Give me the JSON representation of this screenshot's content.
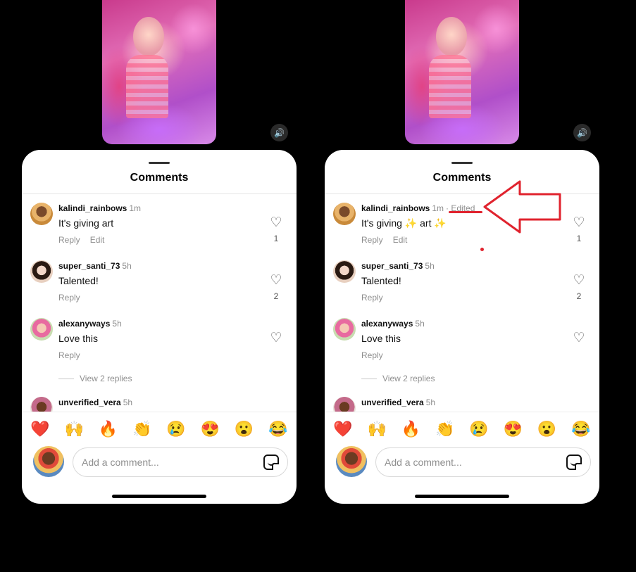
{
  "panels": [
    {
      "sheet_title": "Comments",
      "comments": [
        {
          "username": "kalindi_rainbows",
          "time": "1m",
          "edited": "",
          "text": "It's giving art",
          "actions": [
            "Reply",
            "Edit"
          ],
          "likes": "1"
        },
        {
          "username": "super_santi_73",
          "time": "5h",
          "edited": "",
          "text": "Talented!",
          "actions": [
            "Reply"
          ],
          "likes": "2"
        },
        {
          "username": "alexanyways",
          "time": "5h",
          "edited": "",
          "text": "Love this",
          "actions": [
            "Reply"
          ],
          "likes": ""
        },
        {
          "username": "unverified_vera",
          "time": "5h",
          "edited": "",
          "text": "",
          "actions": [],
          "likes": ""
        }
      ],
      "view_replies": "View 2 replies",
      "emojis": [
        "❤️",
        "🙌",
        "🔥",
        "👏",
        "😢",
        "😍",
        "😮",
        "😂"
      ],
      "composer_placeholder": "Add a comment..."
    },
    {
      "sheet_title": "Comments",
      "comments": [
        {
          "username": "kalindi_rainbows",
          "time": "1m",
          "edited": "· Edited",
          "text": "It's giving ✨ art ✨",
          "actions": [
            "Reply",
            "Edit"
          ],
          "likes": "1"
        },
        {
          "username": "super_santi_73",
          "time": "5h",
          "edited": "",
          "text": "Talented!",
          "actions": [
            "Reply"
          ],
          "likes": "2"
        },
        {
          "username": "alexanyways",
          "time": "5h",
          "edited": "",
          "text": "Love this",
          "actions": [
            "Reply"
          ],
          "likes": ""
        },
        {
          "username": "unverified_vera",
          "time": "5h",
          "edited": "",
          "text": "",
          "actions": [],
          "likes": ""
        }
      ],
      "view_replies": "View 2 replies",
      "emojis": [
        "❤️",
        "🙌",
        "🔥",
        "👏",
        "😢",
        "😍",
        "😮",
        "😂"
      ],
      "composer_placeholder": "Add a comment..."
    }
  ],
  "icons": {
    "sound": "volume-icon",
    "heart": "heart-outline-icon",
    "sticker": "sticker-icon"
  },
  "annotation": {
    "color": "#e0232e",
    "shape": "left-arrow",
    "points_to": "edited-label"
  }
}
